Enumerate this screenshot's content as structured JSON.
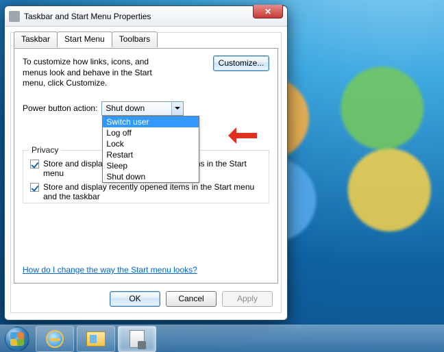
{
  "titlebar": {
    "title": "Taskbar and Start Menu Properties"
  },
  "tabs": {
    "taskbar": "Taskbar",
    "start_menu": "Start Menu",
    "toolbars": "Toolbars"
  },
  "help_text": "To customize how links, icons, and menus look and behave in the Start menu, click Customize.",
  "customize_label": "Customize...",
  "power_label": "Power button action:",
  "power_selected": "Shut down",
  "power_options": {
    "switch_user": "Switch user",
    "log_off": "Log off",
    "lock": "Lock",
    "restart": "Restart",
    "sleep": "Sleep",
    "shut_down": "Shut down"
  },
  "privacy": {
    "legend": "Privacy",
    "opt1": "Store and display recently opened programs in the Start menu",
    "opt2": "Store and display recently opened items in the Start menu and the taskbar"
  },
  "help_link": "How do I change the way the Start menu looks?",
  "buttons": {
    "ok": "OK",
    "cancel": "Cancel",
    "apply": "Apply"
  }
}
